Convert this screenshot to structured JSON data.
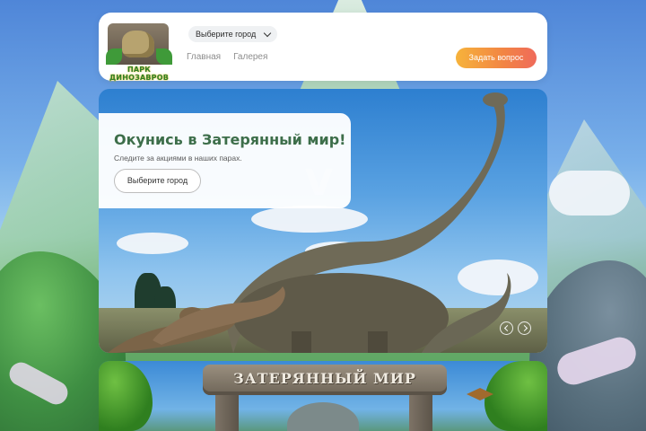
{
  "header": {
    "logo_text": "ПАРК ДИНОЗАВРОВ",
    "city_select": "Выберите город",
    "nav": [
      {
        "label": "Главная"
      },
      {
        "label": "Галерея"
      }
    ],
    "ask_button": "Задать вопрос"
  },
  "hero": {
    "title": "Окунись в Затерянный мир!",
    "subtitle": "Следите за акциями в наших парах.",
    "button": "Выберите город"
  },
  "banner": {
    "sign_text": "ЗАТЕРЯННЫЙ МИР"
  },
  "colors": {
    "accent_orange": "#f28444",
    "accent_yellow": "#f6b33b",
    "title_green": "#3d6e4a"
  }
}
